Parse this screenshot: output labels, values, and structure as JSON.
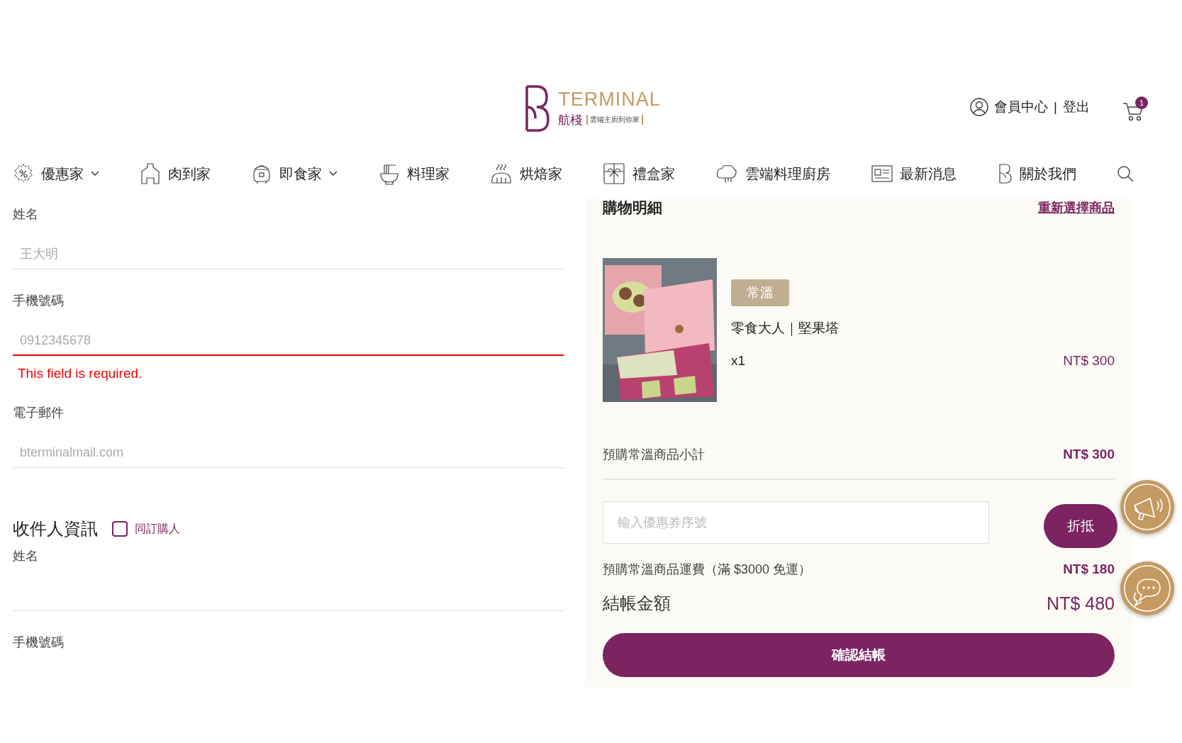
{
  "header": {
    "logo": {
      "brand": "TERMINAL",
      "name": "航棧",
      "tagline": "雲端主廚到你家"
    },
    "account_link": "會員中心",
    "separator": "|",
    "logout_link": "登出",
    "cart_count": "1"
  },
  "nav": [
    {
      "label": "優惠家",
      "has_dropdown": true
    },
    {
      "label": "肉到家",
      "has_dropdown": false
    },
    {
      "label": "即食家",
      "has_dropdown": true
    },
    {
      "label": "料理家",
      "has_dropdown": false
    },
    {
      "label": "烘焙家",
      "has_dropdown": false
    },
    {
      "label": "禮盒家",
      "has_dropdown": false
    },
    {
      "label": "雲端料理廚房",
      "has_dropdown": false
    },
    {
      "label": "最新消息",
      "has_dropdown": false
    },
    {
      "label": "關於我們",
      "has_dropdown": false
    }
  ],
  "buyer_fields": [
    {
      "label": "姓名",
      "placeholder": "王大明",
      "invalid": false
    },
    {
      "label": "手機號碼",
      "placeholder": "0912345678",
      "invalid": true,
      "error": "This field is required."
    },
    {
      "label": "電子郵件",
      "placeholder": "bterminalmail.com",
      "invalid": false
    }
  ],
  "recipient": {
    "title": "收件人資訊",
    "same_as_buyer": {
      "label": "同訂購人",
      "checked": false
    },
    "fields": [
      {
        "label": "姓名",
        "invalid": false
      },
      {
        "label": "手機號碼"
      }
    ]
  },
  "summary": {
    "title": "購物明細",
    "reselect_link": "重新選擇商品",
    "items": [
      {
        "kind": "picture",
        "tag": "常溫",
        "name": "零食大人｜堅果塔",
        "quantity": "x1",
        "price": "NT$ 300"
      }
    ],
    "subtotal_label": "預購常溫商品小計",
    "subtotal": "NT$ 300",
    "coupon": {
      "placeholder": "輸入優惠券序號",
      "button": "折抵"
    },
    "shipping_label": "預購常溫商品運費（滿 $3000 免運）",
    "shipping": "NT$ 180",
    "total_label": "結帳金額",
    "total": "NT$ 480",
    "checkout_button": "確認結帳"
  }
}
